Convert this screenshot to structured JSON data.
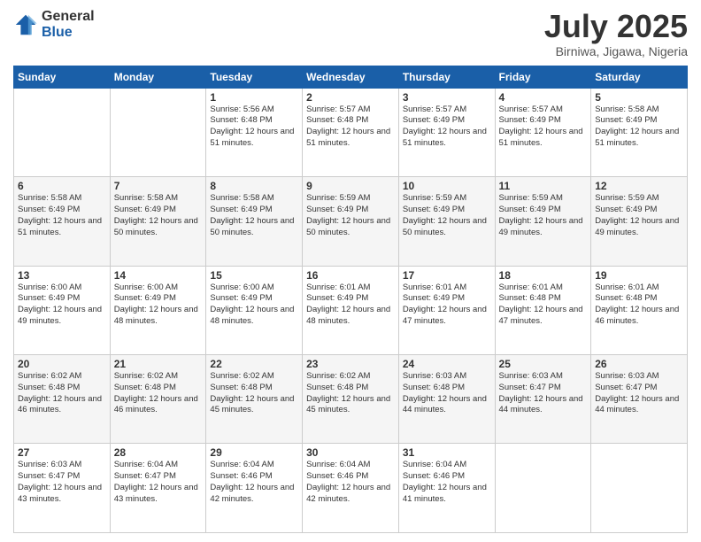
{
  "logo": {
    "general": "General",
    "blue": "Blue"
  },
  "title": "July 2025",
  "location": "Birniwa, Jigawa, Nigeria",
  "weekdays": [
    "Sunday",
    "Monday",
    "Tuesday",
    "Wednesday",
    "Thursday",
    "Friday",
    "Saturday"
  ],
  "weeks": [
    [
      {
        "day": "",
        "info": ""
      },
      {
        "day": "",
        "info": ""
      },
      {
        "day": "1",
        "info": "Sunrise: 5:56 AM\nSunset: 6:48 PM\nDaylight: 12 hours and 51 minutes."
      },
      {
        "day": "2",
        "info": "Sunrise: 5:57 AM\nSunset: 6:48 PM\nDaylight: 12 hours and 51 minutes."
      },
      {
        "day": "3",
        "info": "Sunrise: 5:57 AM\nSunset: 6:49 PM\nDaylight: 12 hours and 51 minutes."
      },
      {
        "day": "4",
        "info": "Sunrise: 5:57 AM\nSunset: 6:49 PM\nDaylight: 12 hours and 51 minutes."
      },
      {
        "day": "5",
        "info": "Sunrise: 5:58 AM\nSunset: 6:49 PM\nDaylight: 12 hours and 51 minutes."
      }
    ],
    [
      {
        "day": "6",
        "info": "Sunrise: 5:58 AM\nSunset: 6:49 PM\nDaylight: 12 hours and 51 minutes."
      },
      {
        "day": "7",
        "info": "Sunrise: 5:58 AM\nSunset: 6:49 PM\nDaylight: 12 hours and 50 minutes."
      },
      {
        "day": "8",
        "info": "Sunrise: 5:58 AM\nSunset: 6:49 PM\nDaylight: 12 hours and 50 minutes."
      },
      {
        "day": "9",
        "info": "Sunrise: 5:59 AM\nSunset: 6:49 PM\nDaylight: 12 hours and 50 minutes."
      },
      {
        "day": "10",
        "info": "Sunrise: 5:59 AM\nSunset: 6:49 PM\nDaylight: 12 hours and 50 minutes."
      },
      {
        "day": "11",
        "info": "Sunrise: 5:59 AM\nSunset: 6:49 PM\nDaylight: 12 hours and 49 minutes."
      },
      {
        "day": "12",
        "info": "Sunrise: 5:59 AM\nSunset: 6:49 PM\nDaylight: 12 hours and 49 minutes."
      }
    ],
    [
      {
        "day": "13",
        "info": "Sunrise: 6:00 AM\nSunset: 6:49 PM\nDaylight: 12 hours and 49 minutes."
      },
      {
        "day": "14",
        "info": "Sunrise: 6:00 AM\nSunset: 6:49 PM\nDaylight: 12 hours and 48 minutes."
      },
      {
        "day": "15",
        "info": "Sunrise: 6:00 AM\nSunset: 6:49 PM\nDaylight: 12 hours and 48 minutes."
      },
      {
        "day": "16",
        "info": "Sunrise: 6:01 AM\nSunset: 6:49 PM\nDaylight: 12 hours and 48 minutes."
      },
      {
        "day": "17",
        "info": "Sunrise: 6:01 AM\nSunset: 6:49 PM\nDaylight: 12 hours and 47 minutes."
      },
      {
        "day": "18",
        "info": "Sunrise: 6:01 AM\nSunset: 6:48 PM\nDaylight: 12 hours and 47 minutes."
      },
      {
        "day": "19",
        "info": "Sunrise: 6:01 AM\nSunset: 6:48 PM\nDaylight: 12 hours and 46 minutes."
      }
    ],
    [
      {
        "day": "20",
        "info": "Sunrise: 6:02 AM\nSunset: 6:48 PM\nDaylight: 12 hours and 46 minutes."
      },
      {
        "day": "21",
        "info": "Sunrise: 6:02 AM\nSunset: 6:48 PM\nDaylight: 12 hours and 46 minutes."
      },
      {
        "day": "22",
        "info": "Sunrise: 6:02 AM\nSunset: 6:48 PM\nDaylight: 12 hours and 45 minutes."
      },
      {
        "day": "23",
        "info": "Sunrise: 6:02 AM\nSunset: 6:48 PM\nDaylight: 12 hours and 45 minutes."
      },
      {
        "day": "24",
        "info": "Sunrise: 6:03 AM\nSunset: 6:48 PM\nDaylight: 12 hours and 44 minutes."
      },
      {
        "day": "25",
        "info": "Sunrise: 6:03 AM\nSunset: 6:47 PM\nDaylight: 12 hours and 44 minutes."
      },
      {
        "day": "26",
        "info": "Sunrise: 6:03 AM\nSunset: 6:47 PM\nDaylight: 12 hours and 44 minutes."
      }
    ],
    [
      {
        "day": "27",
        "info": "Sunrise: 6:03 AM\nSunset: 6:47 PM\nDaylight: 12 hours and 43 minutes."
      },
      {
        "day": "28",
        "info": "Sunrise: 6:04 AM\nSunset: 6:47 PM\nDaylight: 12 hours and 43 minutes."
      },
      {
        "day": "29",
        "info": "Sunrise: 6:04 AM\nSunset: 6:46 PM\nDaylight: 12 hours and 42 minutes."
      },
      {
        "day": "30",
        "info": "Sunrise: 6:04 AM\nSunset: 6:46 PM\nDaylight: 12 hours and 42 minutes."
      },
      {
        "day": "31",
        "info": "Sunrise: 6:04 AM\nSunset: 6:46 PM\nDaylight: 12 hours and 41 minutes."
      },
      {
        "day": "",
        "info": ""
      },
      {
        "day": "",
        "info": ""
      }
    ]
  ]
}
